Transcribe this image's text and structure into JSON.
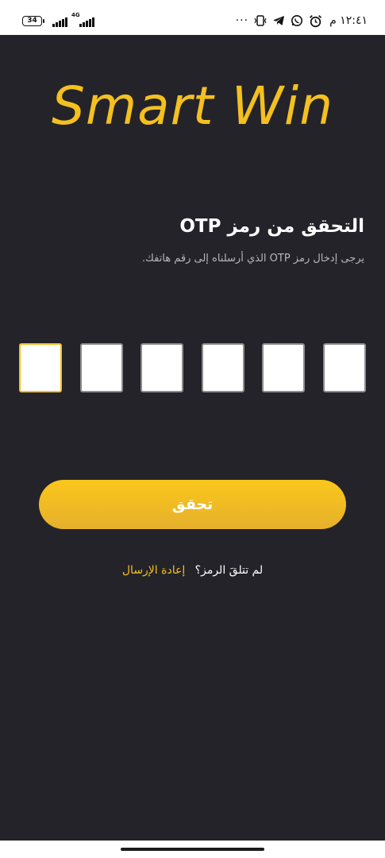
{
  "status_bar": {
    "battery": "34",
    "network": "4G",
    "time": "١٢:٤١ م",
    "more": "···",
    "icons": [
      "alarm-icon",
      "whatsapp-icon",
      "telegram-icon",
      "vibrate-icon"
    ]
  },
  "logo": {
    "text": "Smart Win",
    "color": "#f4c020"
  },
  "otp": {
    "title": "التحقق من رمز OTP",
    "subtitle": "يرجى إدخال رمز OTP الذي أرسلناه إلى رقم هاتفك.",
    "digits": [
      "",
      "",
      "",
      "",
      "",
      ""
    ],
    "active_index": 0
  },
  "verify_button": {
    "label": "تحقق"
  },
  "resend": {
    "question": "لم تتلقَ الرمز؟",
    "link": "إعادة الإرسال"
  },
  "colors": {
    "background": "#242329",
    "accent": "#f4c020",
    "button": "#fbc71b"
  }
}
